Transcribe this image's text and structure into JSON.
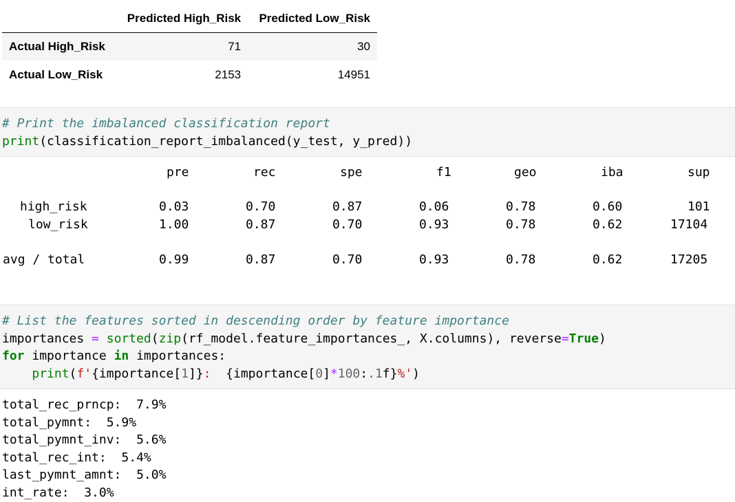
{
  "confusion_matrix": {
    "columns": [
      "",
      "Predicted High_Risk",
      "Predicted Low_Risk"
    ],
    "rows": [
      {
        "label": "Actual High_Risk",
        "values": [
          "71",
          "30"
        ]
      },
      {
        "label": "Actual Low_Risk",
        "values": [
          "2153",
          "14951"
        ]
      }
    ]
  },
  "cell2": {
    "comment": "# Print the imbalanced classification report",
    "code_fn": "print",
    "code_rest": "(classification_report_imbalanced(y_test, y_pred))"
  },
  "report": {
    "headers": [
      "pre",
      "rec",
      "spe",
      "f1",
      "geo",
      "iba",
      "sup"
    ],
    "rows": [
      {
        "label": "high_risk",
        "values": [
          "0.03",
          "0.70",
          "0.87",
          "0.06",
          "0.78",
          "0.60",
          "101"
        ]
      },
      {
        "label": "low_risk",
        "values": [
          "1.00",
          "0.87",
          "0.70",
          "0.93",
          "0.78",
          "0.62",
          "17104"
        ]
      },
      {
        "label": "avg / total",
        "values": [
          "0.99",
          "0.87",
          "0.70",
          "0.93",
          "0.78",
          "0.62",
          "17205"
        ]
      }
    ]
  },
  "cell3": {
    "comment": "# List the features sorted in descending order by feature importance",
    "line2": {
      "a": "importances ",
      "eq": "=",
      "b": " ",
      "fn1": "sorted",
      "c": "(",
      "fn2": "zip",
      "d": "(rf_model.feature_importances_, X.columns), reverse",
      "eq2": "=",
      "kw": "True",
      "e": ")"
    },
    "line3": {
      "for": "for",
      "a": " importance ",
      "in": "in",
      "b": " importances:"
    },
    "line4": {
      "indent": "    ",
      "fn": "print",
      "a": "(",
      "pre": "f",
      "s1": "'",
      "b": "{importance[",
      "n1": "1",
      "c": "]}",
      "s2": ":  ",
      "d": "{importance[",
      "n2": "0",
      "e": "]",
      "op": "*",
      "n3": "100",
      "f": ":",
      "n4": ".1",
      "g": "f}",
      "s3": "%'",
      "h": ")"
    }
  },
  "features_output": [
    "total_rec_prncp:  7.9%",
    "total_pymnt:  5.9%",
    "total_pymnt_inv:  5.6%",
    "total_rec_int:  5.4%",
    "last_pymnt_amnt:  5.0%",
    "int_rate:  3.0%"
  ]
}
